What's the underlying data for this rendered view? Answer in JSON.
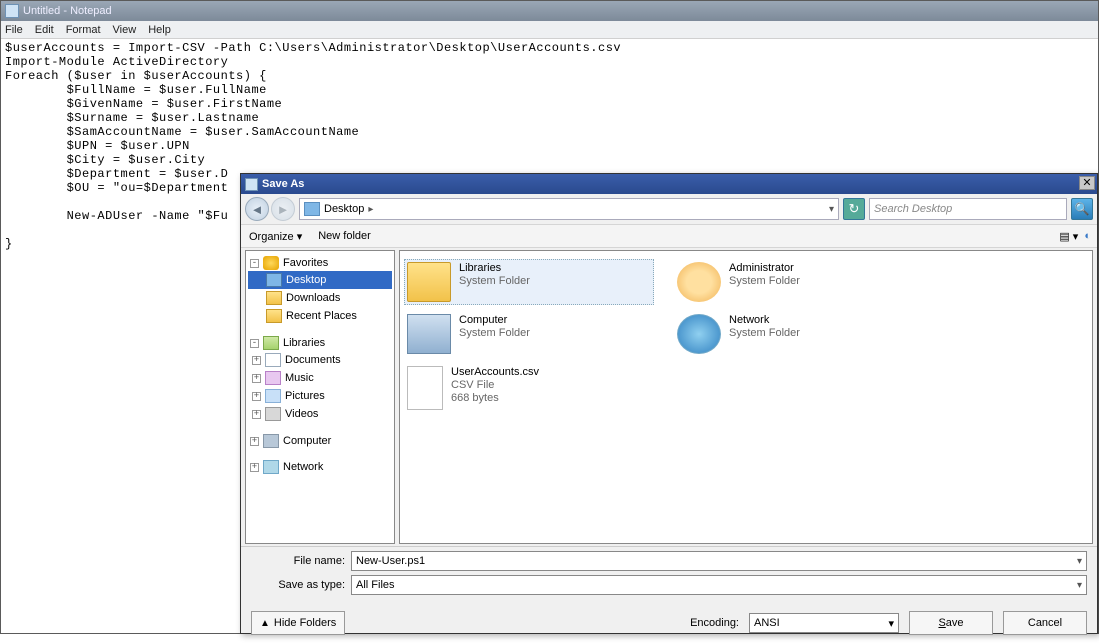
{
  "notepad": {
    "title": "Untitled - Notepad",
    "menu": [
      "File",
      "Edit",
      "Format",
      "View",
      "Help"
    ],
    "content": "$userAccounts = Import-CSV -Path C:\\Users\\Administrator\\Desktop\\UserAccounts.csv\nImport-Module ActiveDirectory\nForeach ($user in $userAccounts) {\n        $FullName = $user.FullName\n        $GivenName = $user.FirstName\n        $Surname = $user.Lastname\n        $SamAccountName = $user.SamAccountName\n        $UPN = $user.UPN\n        $City = $user.City\n        $Department = $user.D\n        $OU = \"ou=$Department\n\n        New-ADUser -Name \"$Fu\n\n}"
  },
  "saveas": {
    "title": "Save As",
    "breadcrumb": "Desktop",
    "search_placeholder": "Search Desktop",
    "toolbar": {
      "organize": "Organize",
      "new_folder": "New folder"
    },
    "tree": {
      "favorites": "Favorites",
      "fav_items": [
        "Desktop",
        "Downloads",
        "Recent Places"
      ],
      "libraries": "Libraries",
      "lib_items": [
        "Documents",
        "Music",
        "Pictures",
        "Videos"
      ],
      "computer": "Computer",
      "network": "Network"
    },
    "items": [
      {
        "name": "Libraries",
        "sub": "System Folder",
        "kind": "folder"
      },
      {
        "name": "Administrator",
        "sub": "System Folder",
        "kind": "user"
      },
      {
        "name": "Computer",
        "sub": "System Folder",
        "kind": "comp"
      },
      {
        "name": "Network",
        "sub": "System Folder",
        "kind": "net"
      },
      {
        "name": "UserAccounts.csv",
        "sub": "CSV File",
        "sub2": "668 bytes",
        "kind": "file"
      }
    ],
    "filename_label": "File name:",
    "filename_value": "New-User.ps1",
    "type_label": "Save as type:",
    "type_value": "All Files",
    "hide_folders": "Hide Folders",
    "encoding_label": "Encoding:",
    "encoding_value": "ANSI",
    "save": "Save",
    "cancel": "Cancel"
  }
}
